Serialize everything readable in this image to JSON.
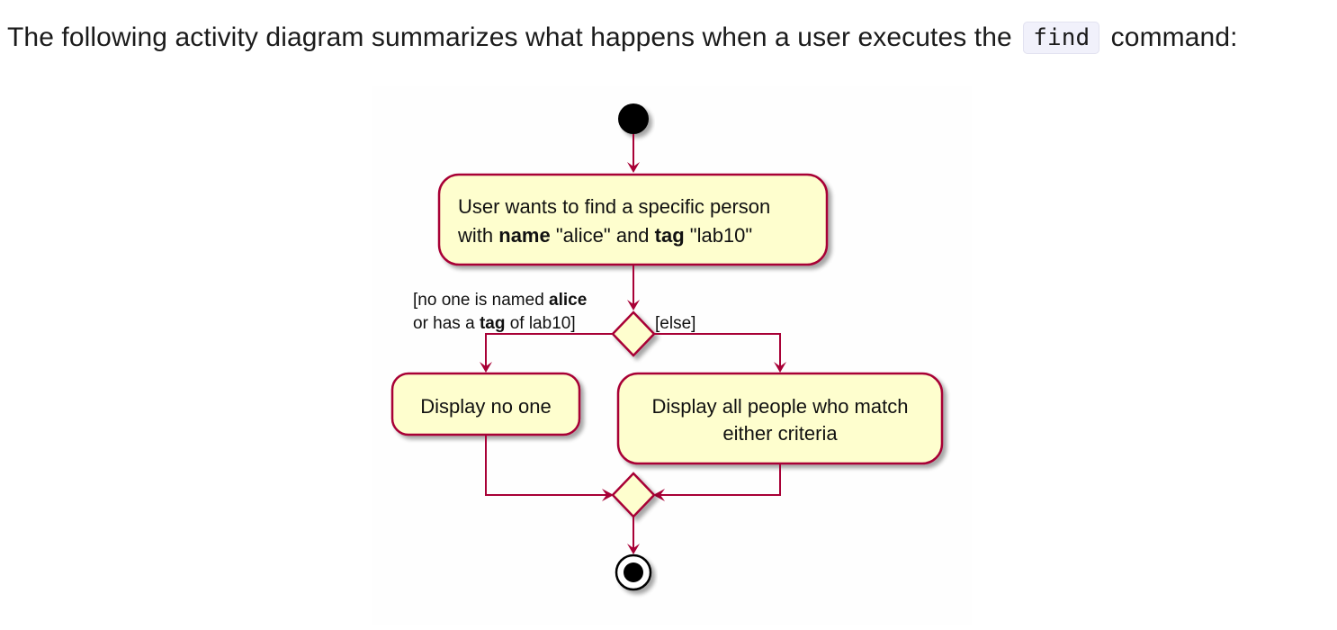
{
  "intro": {
    "before": "The following activity diagram summarizes what happens when a user executes the ",
    "code": "find",
    "after": " command:"
  },
  "diagram": {
    "start_activity": {
      "line1": "User wants to find a specific person",
      "line2_pre": "with ",
      "line2_bold1": "name",
      "line2_mid": " \"alice\" and ",
      "line2_bold2": "tag",
      "line2_post": " \"lab10\""
    },
    "guard_left": {
      "line1_pre": "[no one is named ",
      "line1_bold": "alice",
      "line2_pre": "or has a ",
      "line2_bold": "tag",
      "line2_post": " of lab10]"
    },
    "guard_right": "[else]",
    "activity_left": "Display no one",
    "activity_right": {
      "line1": "Display all people who match",
      "line2": "either criteria"
    },
    "colors": {
      "activity_fill": "#fefece",
      "border": "#a80036",
      "start": "#000000"
    }
  }
}
